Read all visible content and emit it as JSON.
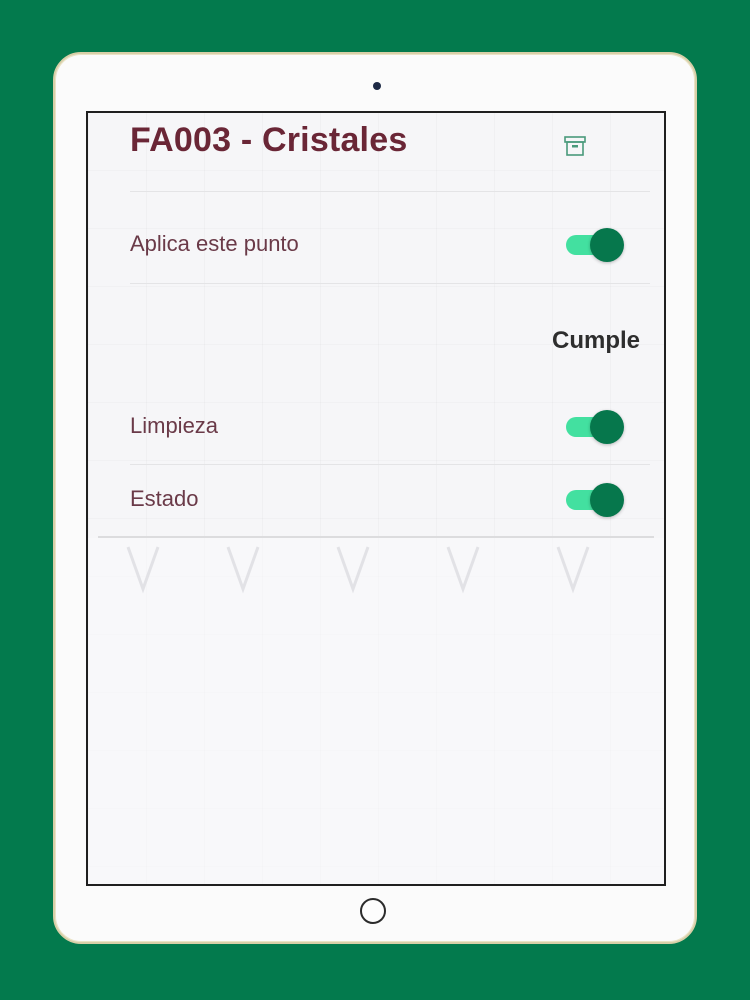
{
  "header": {
    "title": "FA003 - Cristales",
    "archive_icon": "archive-icon"
  },
  "applies": {
    "label": "Aplica este punto",
    "enabled": true
  },
  "section": {
    "header": "Cumple",
    "items": [
      {
        "label": "Limpieza",
        "enabled": true
      },
      {
        "label": "Estado",
        "enabled": true
      }
    ]
  },
  "colors": {
    "background": "#037a4d",
    "title": "#6a2636",
    "toggle_track": "#43e0a0",
    "toggle_thumb": "#06774c"
  }
}
